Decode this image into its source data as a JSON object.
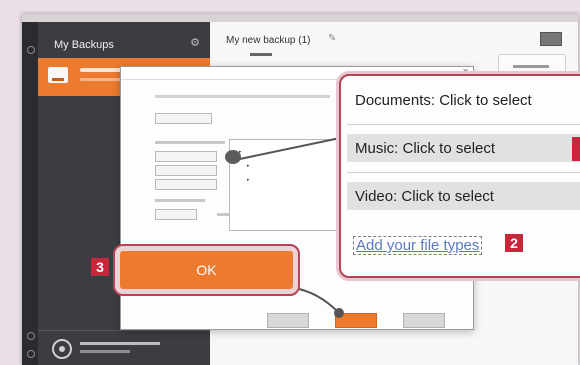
{
  "sidebar": {
    "title": "My Backups",
    "settings_icon": "gear-icon"
  },
  "main": {
    "title": "My new backup (1)"
  },
  "zoom_panel": {
    "rows": [
      {
        "label": "Documents: Click to select"
      },
      {
        "label": "Music: Click to select"
      },
      {
        "label": "Video: Click to select"
      }
    ],
    "add_link": "Add your file types"
  },
  "big_button": {
    "label": "OK"
  },
  "badges": {
    "two": "2",
    "three": "3"
  },
  "colors": {
    "accent": "#ec7a2f",
    "sidebar": "#3b3d42",
    "callout_border": "#b44456",
    "badge": "#c9253b"
  }
}
